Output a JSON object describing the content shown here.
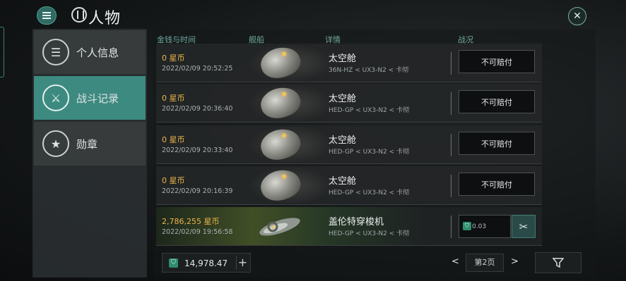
{
  "header": {
    "title": "人物"
  },
  "sidebar": {
    "items": [
      {
        "label": "个人信息",
        "icon": "menu-lines-icon"
      },
      {
        "label": "战斗记录",
        "icon": "crossed-swords-icon"
      },
      {
        "label": "勋章",
        "icon": "star-hexagon-icon"
      }
    ],
    "active_index": 1
  },
  "table": {
    "headers": {
      "money_time": "金钱与时间",
      "ship": "舰船",
      "details": "详情",
      "result": "战况"
    },
    "rows": [
      {
        "money": "0  星币",
        "time": "2022/02/09  20:52:25",
        "ship": "太空舱",
        "route": "36N-HZ < UX3-N2 < 卡彻",
        "status": "不可赔付"
      },
      {
        "money": "0  星币",
        "time": "2022/02/09  20:36:40",
        "ship": "太空舱",
        "route": "HED-GP < UX3-N2 < 卡彻",
        "status": "不可赔付"
      },
      {
        "money": "0  星币",
        "time": "2022/02/09  20:33:40",
        "ship": "太空舱",
        "route": "HED-GP < UX3-N2 < 卡彻",
        "status": "不可赔付"
      },
      {
        "money": "0  星币",
        "time": "2022/02/09  20:16:39",
        "ship": "太空舱",
        "route": "HED-GP < UX3-N2 < 卡彻",
        "status": "不可赔付"
      },
      {
        "money": "2,786,255  星币",
        "time": "2022/02/09  19:56:58",
        "ship": "盖伦特穿梭机",
        "route": "HED-GP < UX3-N2 < 卡彻",
        "loss_value": "0.03"
      }
    ]
  },
  "footer": {
    "balance": "14,978.47",
    "add_symbol": "+",
    "page_label": "第2页",
    "prev_symbol": "<",
    "next_symbol": ">"
  },
  "colors": {
    "accent": "#3d8a80",
    "money": "#e8b54a",
    "header_text": "#6fa79e"
  }
}
